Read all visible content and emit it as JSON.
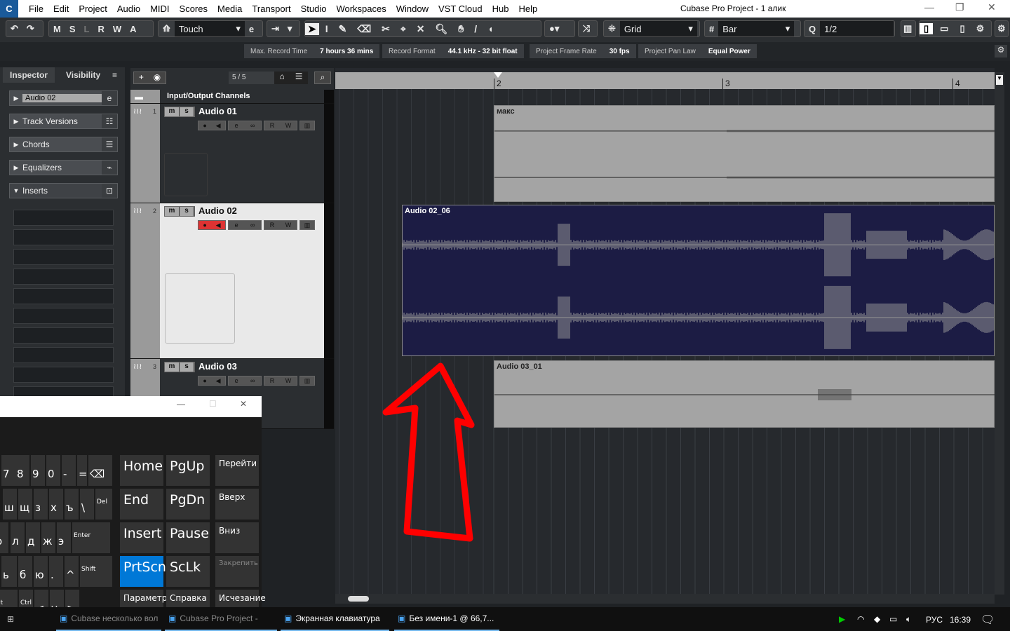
{
  "window": {
    "title": "Cubase Pro Project - 1 алик",
    "menu": [
      "File",
      "Edit",
      "Project",
      "Audio",
      "MIDI",
      "Scores",
      "Media",
      "Transport",
      "Studio",
      "Workspaces",
      "Window",
      "VST Cloud",
      "Hub",
      "Help"
    ]
  },
  "toolbar": {
    "msrwa": [
      "M",
      "S",
      "L",
      "R",
      "W",
      "A"
    ],
    "automation_mode": "Touch",
    "snap_type": "Grid",
    "grid_type": "Bar",
    "quantize": "1/2"
  },
  "infobar": [
    {
      "label": "Max. Record Time",
      "value": "7 hours 36 mins"
    },
    {
      "label": "Record Format",
      "value": "44.1 kHz - 32 bit float"
    },
    {
      "label": "Project Frame Rate",
      "value": "30 fps"
    },
    {
      "label": "Project Pan Law",
      "value": "Equal Power"
    }
  ],
  "inspector": {
    "tabs": [
      "Inspector",
      "Visibility"
    ],
    "track": "Audio 02",
    "sections": [
      "Track Versions",
      "Chords",
      "Equalizers",
      "Inserts"
    ]
  },
  "tracklist": {
    "count": "5 / 5",
    "folder": "Input/Output Channels",
    "tracks": [
      {
        "num": "1",
        "name": "Audio 01"
      },
      {
        "num": "2",
        "name": "Audio 02"
      },
      {
        "num": "3",
        "name": "Audio 03"
      }
    ]
  },
  "ruler": [
    "2",
    "3",
    "4"
  ],
  "events": [
    {
      "name": "макс"
    },
    {
      "name": "Audio 02_06"
    },
    {
      "name": "Audio 03_01"
    }
  ],
  "annotation_color": "#ff0000",
  "keyboard": {
    "keys": [
      [
        "7",
        "8",
        "9",
        "0",
        "-",
        "=",
        "⌫"
      ],
      [
        "ш",
        "щ",
        "з",
        "х",
        "ъ",
        "\\",
        "Del"
      ],
      [
        "о",
        "л",
        "д",
        "ж",
        "э",
        "Enter"
      ],
      [
        "ь",
        "б",
        "ю",
        ".",
        "^",
        "Shift"
      ],
      [
        "Alt",
        "Ctrl",
        "<",
        "v",
        ">"
      ]
    ],
    "nav": [
      [
        "Home",
        "PgUp",
        "Перейти"
      ],
      [
        "End",
        "PgDn",
        "Вверх"
      ],
      [
        "Insert",
        "Pause",
        "Вниз"
      ],
      [
        "PrtScn",
        "ScLk",
        "Закрепить"
      ],
      [
        "Параметры",
        "Справка",
        "Исчезание"
      ]
    ]
  },
  "taskbar": {
    "items": [
      "Cubase несколько вол",
      "Cubase Pro Project -",
      "Экранная клавиатура",
      "Без имени-1 @ 66,7..."
    ],
    "lang": "РУС",
    "time": "16:39"
  }
}
